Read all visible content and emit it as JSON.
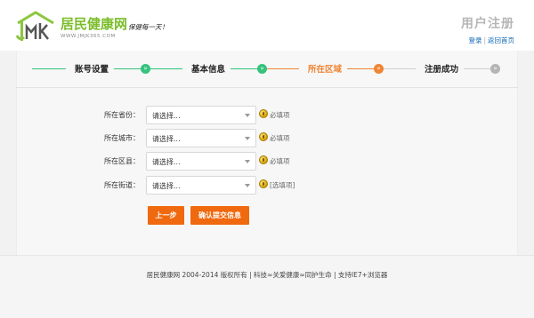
{
  "header": {
    "logo_name": "居民健康网",
    "logo_url": "WWW.JMJK365.COM",
    "logo_slogan": "保健每一天！",
    "title": "用户注册",
    "login_link": "登录",
    "links_sep": "|",
    "home_link": "返回首页"
  },
  "steps": [
    {
      "label": "账号设置",
      "state": "done"
    },
    {
      "label": "基本信息",
      "state": "done"
    },
    {
      "label": "所在区域",
      "state": "active"
    },
    {
      "label": "注册成功",
      "state": "todo"
    }
  ],
  "colors": {
    "done": "#34c37c",
    "active": "#f08434",
    "todo": "#b5b5b5",
    "button": "#f0690f",
    "link": "#0c66b3"
  },
  "form": {
    "province": {
      "label": "所在省份：",
      "value": "请选择...",
      "note": "必填项"
    },
    "city": {
      "label": "所在城市：",
      "value": "请选择...",
      "note": "必填项"
    },
    "district": {
      "label": "所在区县：",
      "value": "请选择...",
      "note": "必填项"
    },
    "street": {
      "label": "所在街道：",
      "value": "请选择...",
      "note": "[选填项]"
    }
  },
  "buttons": {
    "prev": "上一步",
    "submit": "确认提交信息"
  },
  "footer": {
    "text": "居民健康网 2004-2014 版权所有 | 科技≈关爱健康≈同护生命 | 支持IE7+浏览器"
  }
}
